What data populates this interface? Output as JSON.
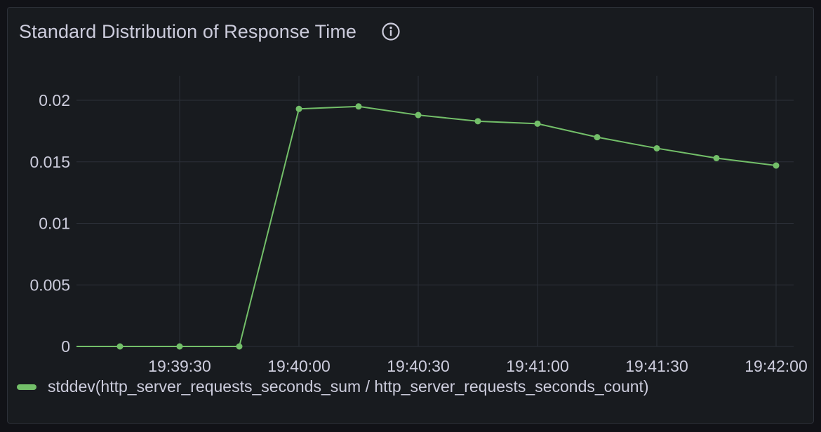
{
  "panel": {
    "title": "Standard Distribution of Response Time",
    "info_icon": "info-circle-icon"
  },
  "colors": {
    "background": "#181b1f",
    "grid": "#2c3038",
    "text": "#ccccdc",
    "series": "#73bf69"
  },
  "chart_data": {
    "type": "line",
    "title": "Standard Distribution of Response Time",
    "xlabel": "",
    "ylabel": "",
    "x_tick_labels": [
      "19:39:30",
      "19:40:00",
      "19:40:30",
      "19:41:00",
      "19:41:30",
      "19:42:00"
    ],
    "y_tick_labels": [
      "0",
      "0.005",
      "0.01",
      "0.015",
      "0.02"
    ],
    "y_ticks": [
      0,
      0.005,
      0.01,
      0.015,
      0.02
    ],
    "x_range": [
      "19:39:00",
      "19:42:05"
    ],
    "ylim": [
      0,
      0.02
    ],
    "grid": true,
    "legend_placement": "bottom-left",
    "series": [
      {
        "name": "stddev(http_server_requests_seconds_sum / http_server_requests_seconds_count)",
        "x": [
          "19:39:15",
          "19:39:30",
          "19:39:45",
          "19:40:00",
          "19:40:15",
          "19:40:30",
          "19:40:45",
          "19:41:00",
          "19:41:15",
          "19:41:30",
          "19:41:45",
          "19:42:00"
        ],
        "values": [
          0,
          0,
          0,
          0.0193,
          0.0195,
          0.0188,
          0.0183,
          0.0181,
          0.017,
          0.0161,
          0.0153,
          0.0147
        ],
        "line_start_value": 0
      }
    ]
  }
}
